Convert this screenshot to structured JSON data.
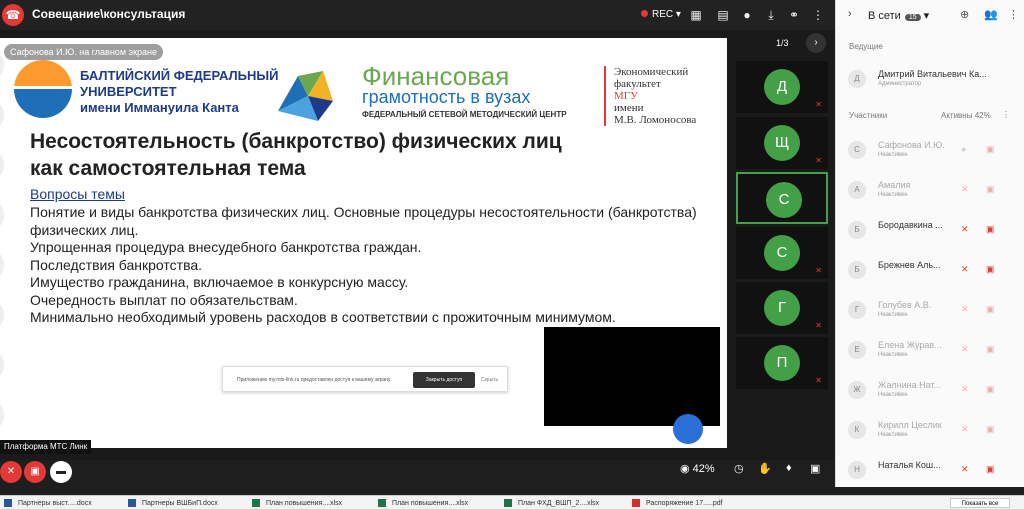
{
  "header": {
    "title": "Совещание\\консультация",
    "rec_label": "REC"
  },
  "sharer_label": "Сафонова И.Ю. на главном экране",
  "slide": {
    "uni_line1": "БАЛТИЙСКИЙ ФЕДЕРАЛЬНЫЙ",
    "uni_line2": "УНИВЕРСИТЕТ",
    "uni_line3": "имени Иммануила Канта",
    "fin_line1": "Финансовая",
    "fin_line2": "грамотность в вузах",
    "fin_line3": "ФЕДЕРАЛЬНЫЙ СЕТЕВОЙ МЕТОДИЧЕСКИЙ ЦЕНТР",
    "eco_line1": "Экономический",
    "eco_line2": "факультет",
    "eco_line3": "МГУ",
    "eco_line4": "имени",
    "eco_line5": "М.В. Ломоносова",
    "title_line1": "Несостоятельность (банкротство) физических лиц",
    "title_line2": "как самостоятельная тема",
    "topics_heading": "Вопросы темы",
    "topics": [
      "Понятие и виды банкротства физических лиц. Основные процедуры несостоятельности (банкротства)",
      "физических лиц.",
      "Упрощенная процедура внесудебного банкротства граждан.",
      "Последствия банкротства.",
      "Имущество гражданина, включаемое в конкурсную массу.",
      "Очередность выплат по обязательствам.",
      "Минимально необходимый уровень расходов в соответствии с прожиточным минимумом."
    ]
  },
  "share_banner": {
    "text": "Приложению my.mts-link.ru предоставлен доступ к вашему экрану.",
    "button": "Закрыть доступ",
    "skip": "Скрыть"
  },
  "page_counter": "1/3",
  "tiles": [
    "Д",
    "Щ",
    "С",
    "С",
    "Г",
    "П"
  ],
  "platform_label": "Платформа МТС Линк",
  "zoom": "42%",
  "panel": {
    "online_label": "В сети",
    "online_count": "15",
    "hosts_label": "Ведущие",
    "participants_label": "Участники",
    "active_label": "Активны 42%",
    "host": {
      "initial": "Д",
      "name": "Дмитрий Витальевич Ка...",
      "role": "Администратор"
    },
    "participants": [
      {
        "initial": "С",
        "name": "Сафонова И.Ю.",
        "status": "Неактивен"
      },
      {
        "initial": "А",
        "name": "Амалия",
        "status": "Неактивен"
      },
      {
        "initial": "Б",
        "name": "Бородавкина ...",
        "status": ""
      },
      {
        "initial": "Б",
        "name": "Брежнев Аль...",
        "status": ""
      },
      {
        "initial": "Г",
        "name": "Голубев А.В.",
        "status": "Неактивен"
      },
      {
        "initial": "Е",
        "name": "Елена Журав...",
        "status": "Неактивен"
      },
      {
        "initial": "Ж",
        "name": "Жалнина Нат...",
        "status": "Неактивен"
      },
      {
        "initial": "К",
        "name": "Кирилл Цеслик",
        "status": "Неактивен"
      },
      {
        "initial": "Н",
        "name": "Наталья Кош...",
        "status": ""
      }
    ]
  },
  "taskbar": {
    "items": [
      "Партнеры выст.....docx",
      "Партнеры ВШБиП.docx",
      "План повышения....xlsx",
      "План повышения....xlsx",
      "План ФХД_ВШП_2....xlsx",
      "Распоряжение 17.....pdf"
    ],
    "show_all": "Показать все"
  },
  "colors": {
    "accent_green": "#43a047",
    "danger_red": "#e53935",
    "brand_blue": "#1e3a8a"
  }
}
